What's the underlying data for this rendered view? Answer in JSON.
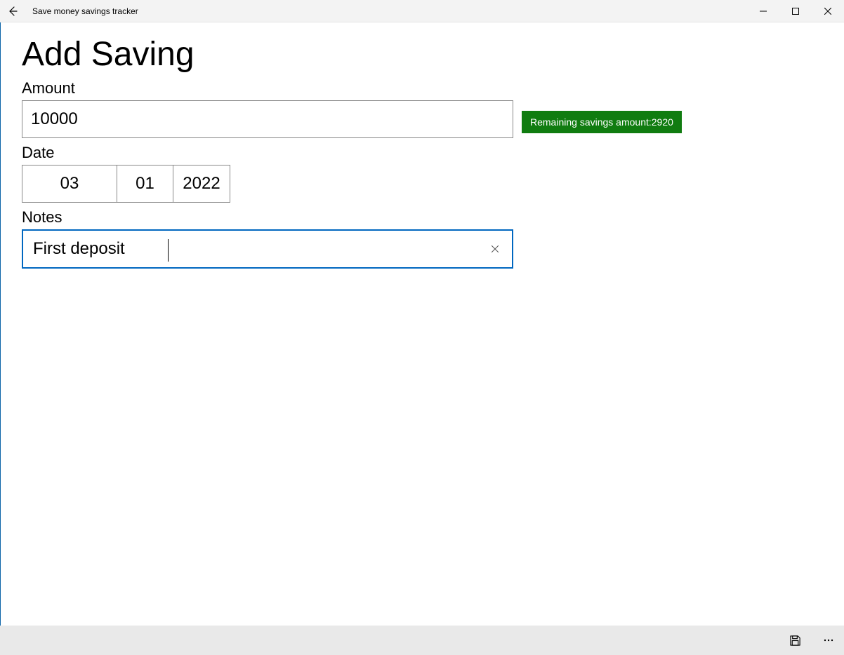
{
  "window": {
    "title": "Save money savings tracker"
  },
  "page": {
    "heading": "Add Saving"
  },
  "form": {
    "amount": {
      "label": "Amount",
      "value": "10000"
    },
    "date": {
      "label": "Date",
      "month": "03",
      "day": "01",
      "year": "2022"
    },
    "notes": {
      "label": "Notes",
      "value": "First deposit"
    }
  },
  "status": {
    "remaining_label": "Remaining savings amount:",
    "remaining_value": "2920"
  },
  "colors": {
    "accent": "#0067c0",
    "badge_bg": "#107c10"
  }
}
